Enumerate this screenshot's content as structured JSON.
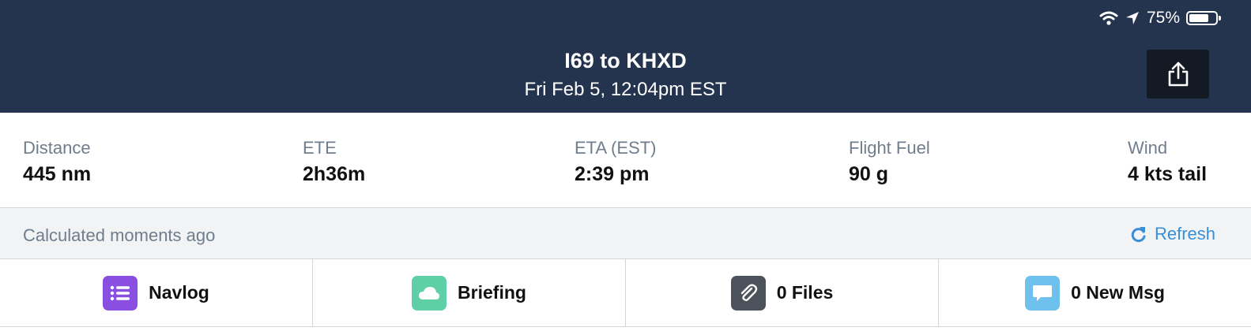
{
  "status_bar": {
    "battery": "75%",
    "battery_level": 0.75
  },
  "header": {
    "title": "I69 to KHXD",
    "subtitle": "Fri Feb 5, 12:04pm EST"
  },
  "stats": [
    {
      "label": "Distance",
      "value": "445 nm"
    },
    {
      "label": "ETE",
      "value": "2h36m"
    },
    {
      "label": "ETA (EST)",
      "value": "2:39 pm"
    },
    {
      "label": "Flight Fuel",
      "value": "90 g"
    },
    {
      "label": "Wind",
      "value": "4 kts tail"
    }
  ],
  "calc": {
    "text": "Calculated moments ago",
    "refresh_label": "Refresh"
  },
  "tabs": [
    {
      "label": "Navlog",
      "icon": "list-icon",
      "color": "#8a4fe0"
    },
    {
      "label": "Briefing",
      "icon": "cloud-icon",
      "color": "#5fd0a6"
    },
    {
      "label": "0 Files",
      "icon": "paperclip-icon",
      "color": "#4b525b"
    },
    {
      "label": "0 New Msg",
      "icon": "chat-bubble-icon",
      "color": "#6ec1ec"
    }
  ]
}
